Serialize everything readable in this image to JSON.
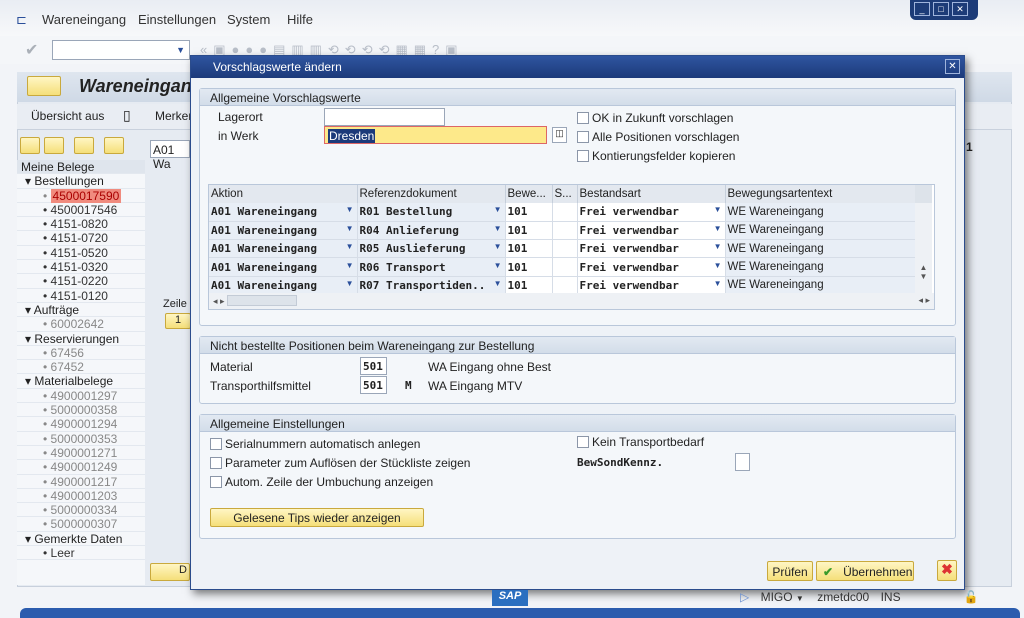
{
  "menu": {
    "items": [
      "Wareneingang",
      "Einstellungen",
      "System",
      "Hilfe"
    ]
  },
  "main": {
    "title": "Wareneingang",
    "toolbar": {
      "overview": "Übersicht aus",
      "merker": "Merker"
    },
    "action_field": "A01 Wa",
    "zeile": "Zeile",
    "row_num": "1",
    "right_num": "1",
    "button_d": "D"
  },
  "tree": {
    "header": "Meine Belege",
    "groups": [
      {
        "label": "Bestellungen",
        "items": [
          "4500017590",
          "4500017546",
          "4151-0820",
          "4151-0720",
          "4151-0520",
          "4151-0320",
          "4151-0220",
          "4151-0120"
        ]
      },
      {
        "label": "Aufträge",
        "items": [
          "60002642"
        ]
      },
      {
        "label": "Reservierungen",
        "items": [
          "67456",
          "67452"
        ]
      },
      {
        "label": "Materialbelege",
        "items": [
          "4900001297",
          "5000000358",
          "4900001294",
          "5000000353",
          "4900001271",
          "4900001249",
          "4900001217",
          "4900001203",
          "5000000334",
          "5000000307"
        ]
      },
      {
        "label": "Gemerkte Daten",
        "items": [
          "Leer"
        ]
      }
    ]
  },
  "dialog": {
    "title": "Vorschlagswerte ändern",
    "sec1": {
      "title": "Allgemeine Vorschlagswerte",
      "lagerort_label": "Lagerort",
      "lagerort_value": "",
      "werk_label": "in Werk",
      "werk_value": "Dresden",
      "checkboxes": [
        "OK in Zukunft vorschlagen",
        "Alle Positionen vorschlagen",
        "Kontierungsfelder kopieren"
      ],
      "grid": {
        "columns": [
          "Aktion",
          "Referenzdokument",
          "Bewe...",
          "S...",
          "Bestandsart",
          "Bewegungsartentext"
        ],
        "rows": [
          [
            "A01 Wareneingang",
            "R01 Bestellung",
            "101",
            "",
            "Frei verwendbar",
            "WE Wareneingang"
          ],
          [
            "A01 Wareneingang",
            "R04 Anlieferung",
            "101",
            "",
            "Frei verwendbar",
            "WE Wareneingang"
          ],
          [
            "A01 Wareneingang",
            "R05 Auslieferung",
            "101",
            "",
            "Frei verwendbar",
            "WE Wareneingang"
          ],
          [
            "A01 Wareneingang",
            "R06 Transport",
            "101",
            "",
            "Frei verwendbar",
            "WE Wareneingang"
          ],
          [
            "A01 Wareneingang",
            "R07 Transportiden..",
            "101",
            "",
            "Frei verwendbar",
            "WE Wareneingang"
          ]
        ]
      }
    },
    "sec2": {
      "title": "Nicht bestellte Positionen beim Wareneingang zur Bestellung",
      "material_label": "Material",
      "material_value": "501",
      "material_text": "WA Eingang ohne Best",
      "th_label": "Transporthilfsmittel",
      "th_value": "501",
      "th_flag": "M",
      "th_text": "WA Eingang MTV"
    },
    "sec3": {
      "title": "Allgemeine Einstellungen",
      "checkboxes": [
        "Serialnummern automatisch anlegen",
        "Parameter zum Auflösen der Stückliste zeigen",
        "Autom. Zeile der Umbuchung anzeigen"
      ],
      "kein_transport": "Kein Transportbedarf",
      "bewsond_label": "BewSondKennz.",
      "tips_button": "Gelesene Tips wieder anzeigen"
    },
    "buttons": {
      "pruefen": "Prüfen",
      "uebernehmen": "Übernehmen"
    }
  },
  "status": {
    "tcode": "MIGO",
    "server": "zmetdc00",
    "mode": "INS"
  },
  "colors": {
    "dialog_title": "#1c3a7a",
    "selected_tree": "#f08b7e",
    "button_yellow": "#f5df7a"
  }
}
